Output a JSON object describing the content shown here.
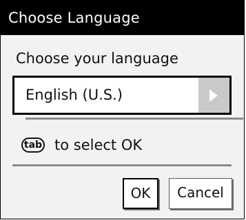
{
  "dialog": {
    "title": "Choose Language",
    "prompt": "Choose your language",
    "language_select": {
      "selected": "English (U.S.)"
    },
    "hint": {
      "key_label": "tab",
      "text": "to select OK"
    },
    "buttons": {
      "ok_label": "OK",
      "cancel_label": "Cancel"
    }
  }
}
